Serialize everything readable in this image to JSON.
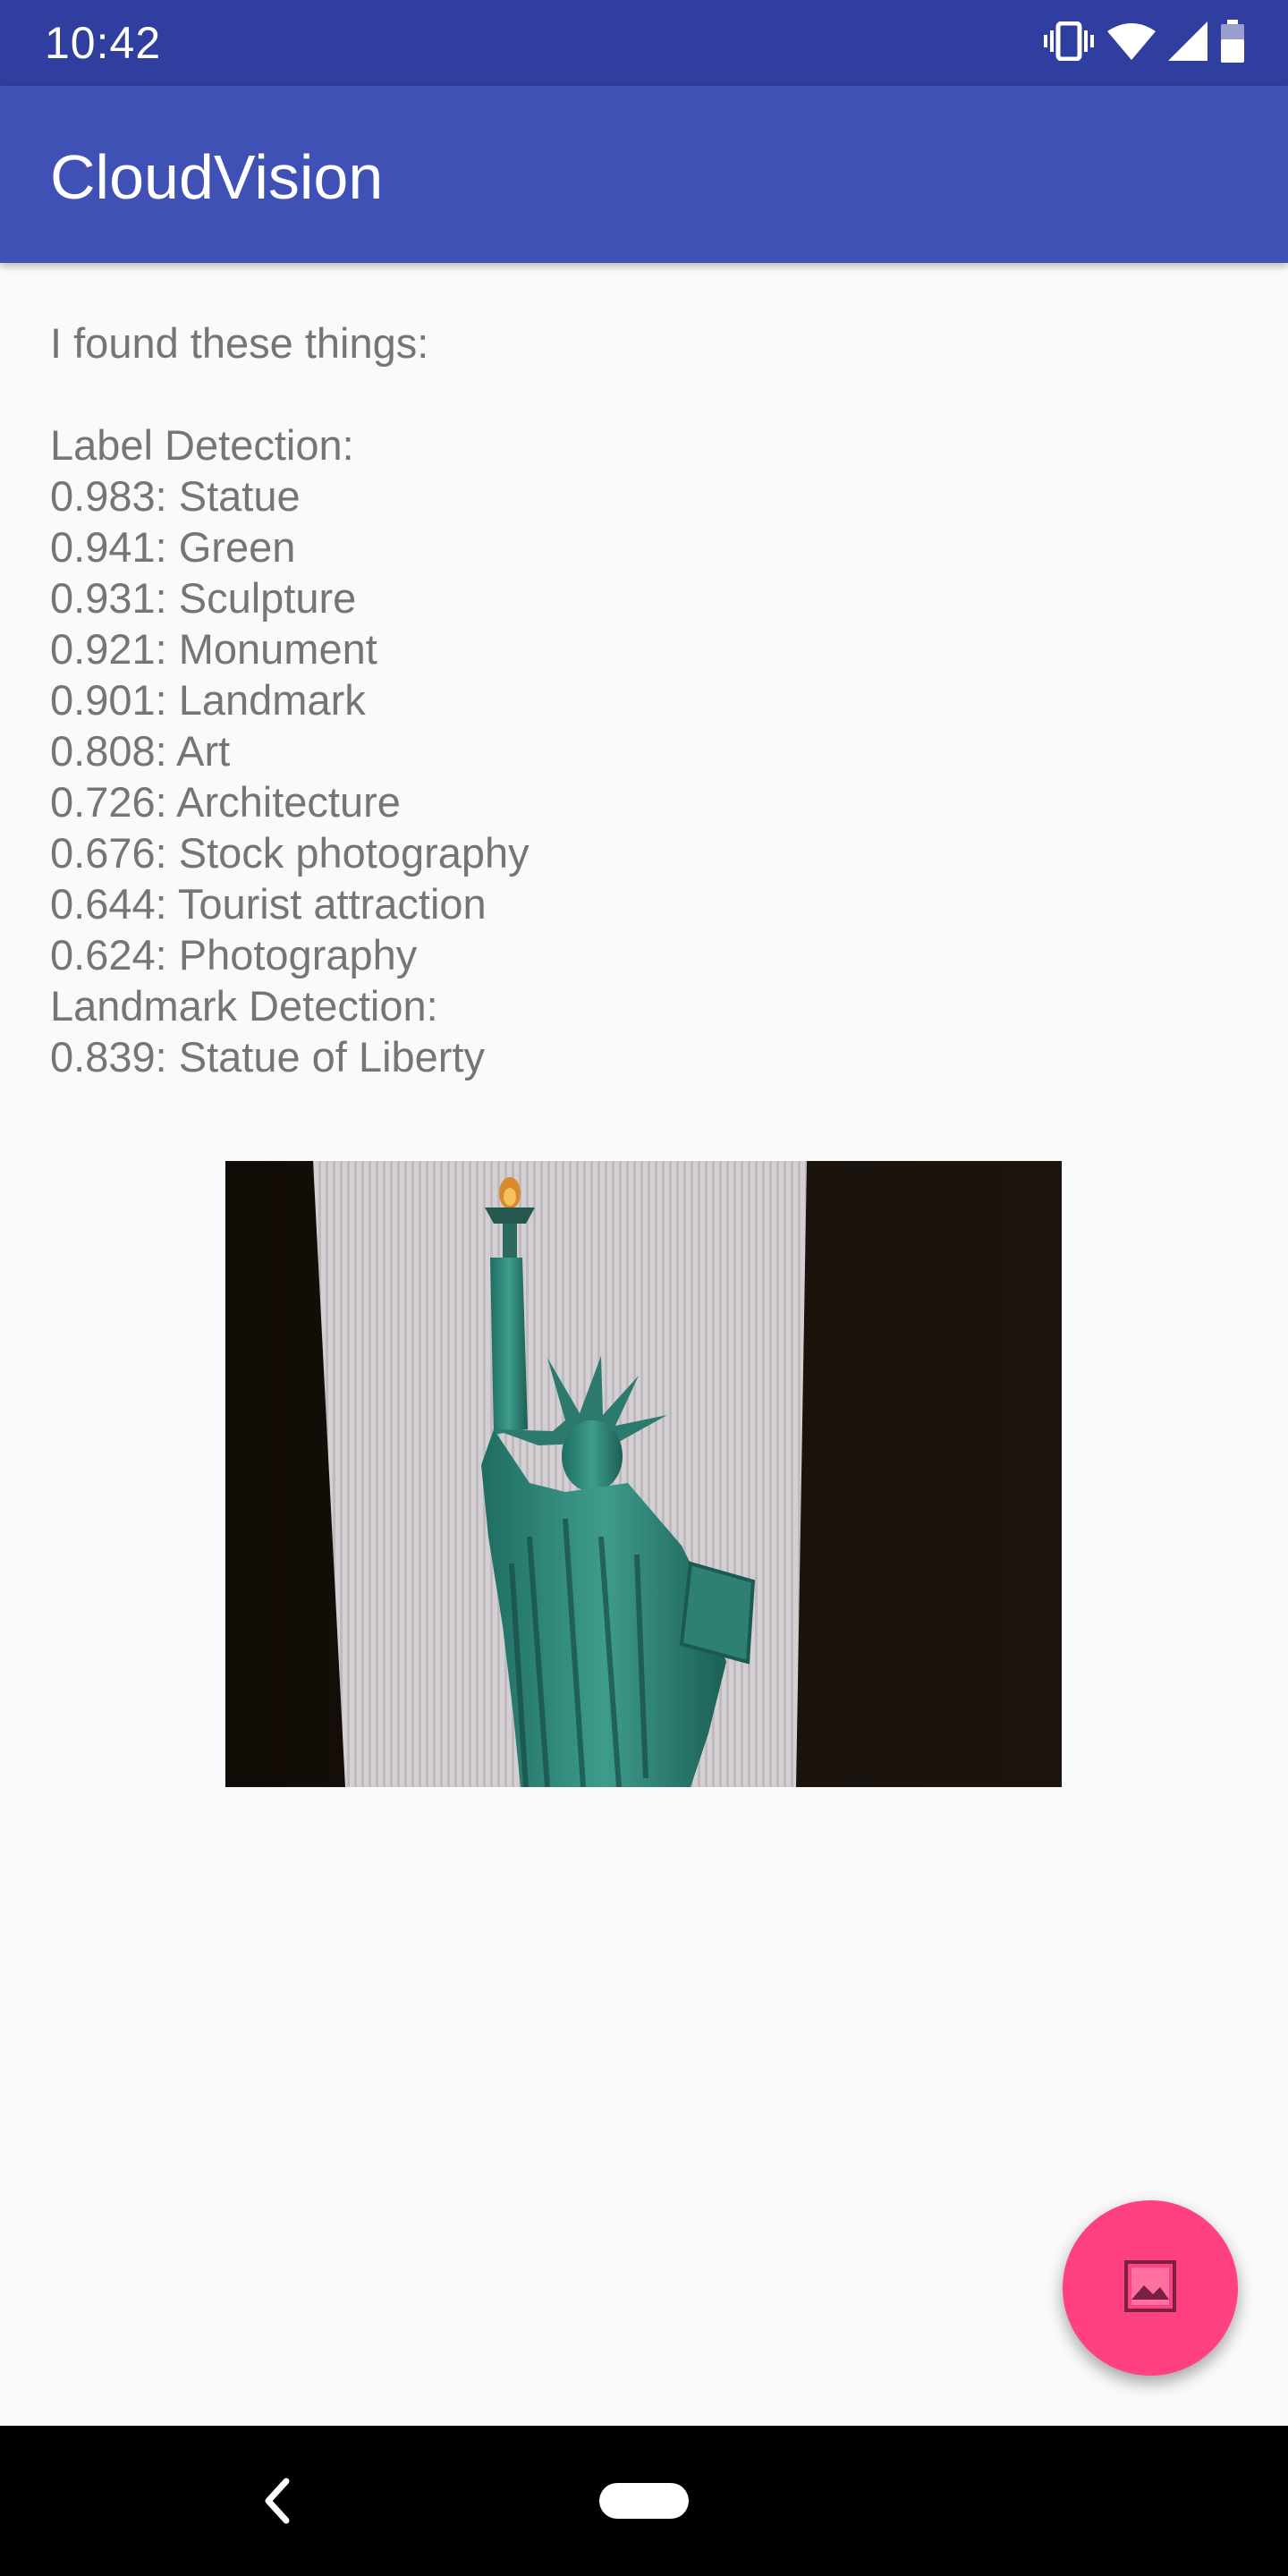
{
  "status_bar": {
    "time": "10:42",
    "icons": [
      "vibrate-icon",
      "wifi-icon",
      "signal-icon",
      "battery-icon"
    ]
  },
  "app_bar": {
    "title": "CloudVision"
  },
  "results": {
    "intro": "I found these things:",
    "label_heading": "Label Detection:",
    "labels": [
      "0.983: Statue",
      "0.941: Green",
      "0.931: Sculpture",
      "0.921: Monument",
      "0.901: Landmark",
      "0.808: Art",
      "0.726: Architecture",
      "0.676: Stock photography",
      "0.644: Tourist attraction",
      "0.624: Photography"
    ],
    "landmark_heading": "Landmark Detection:",
    "landmarks": [
      "0.839: Statue of Liberty"
    ]
  },
  "image": {
    "subject": "statue-of-liberty-photo"
  },
  "fab": {
    "icon": "image-gallery-icon",
    "color": "#ff4081"
  },
  "nav_bar": {
    "icons": [
      "back-icon",
      "home-pill"
    ]
  },
  "colors": {
    "primary": "#3f51b5",
    "primary_dark": "#303f9f",
    "accent": "#ff4081",
    "text_secondary": "#757575"
  }
}
